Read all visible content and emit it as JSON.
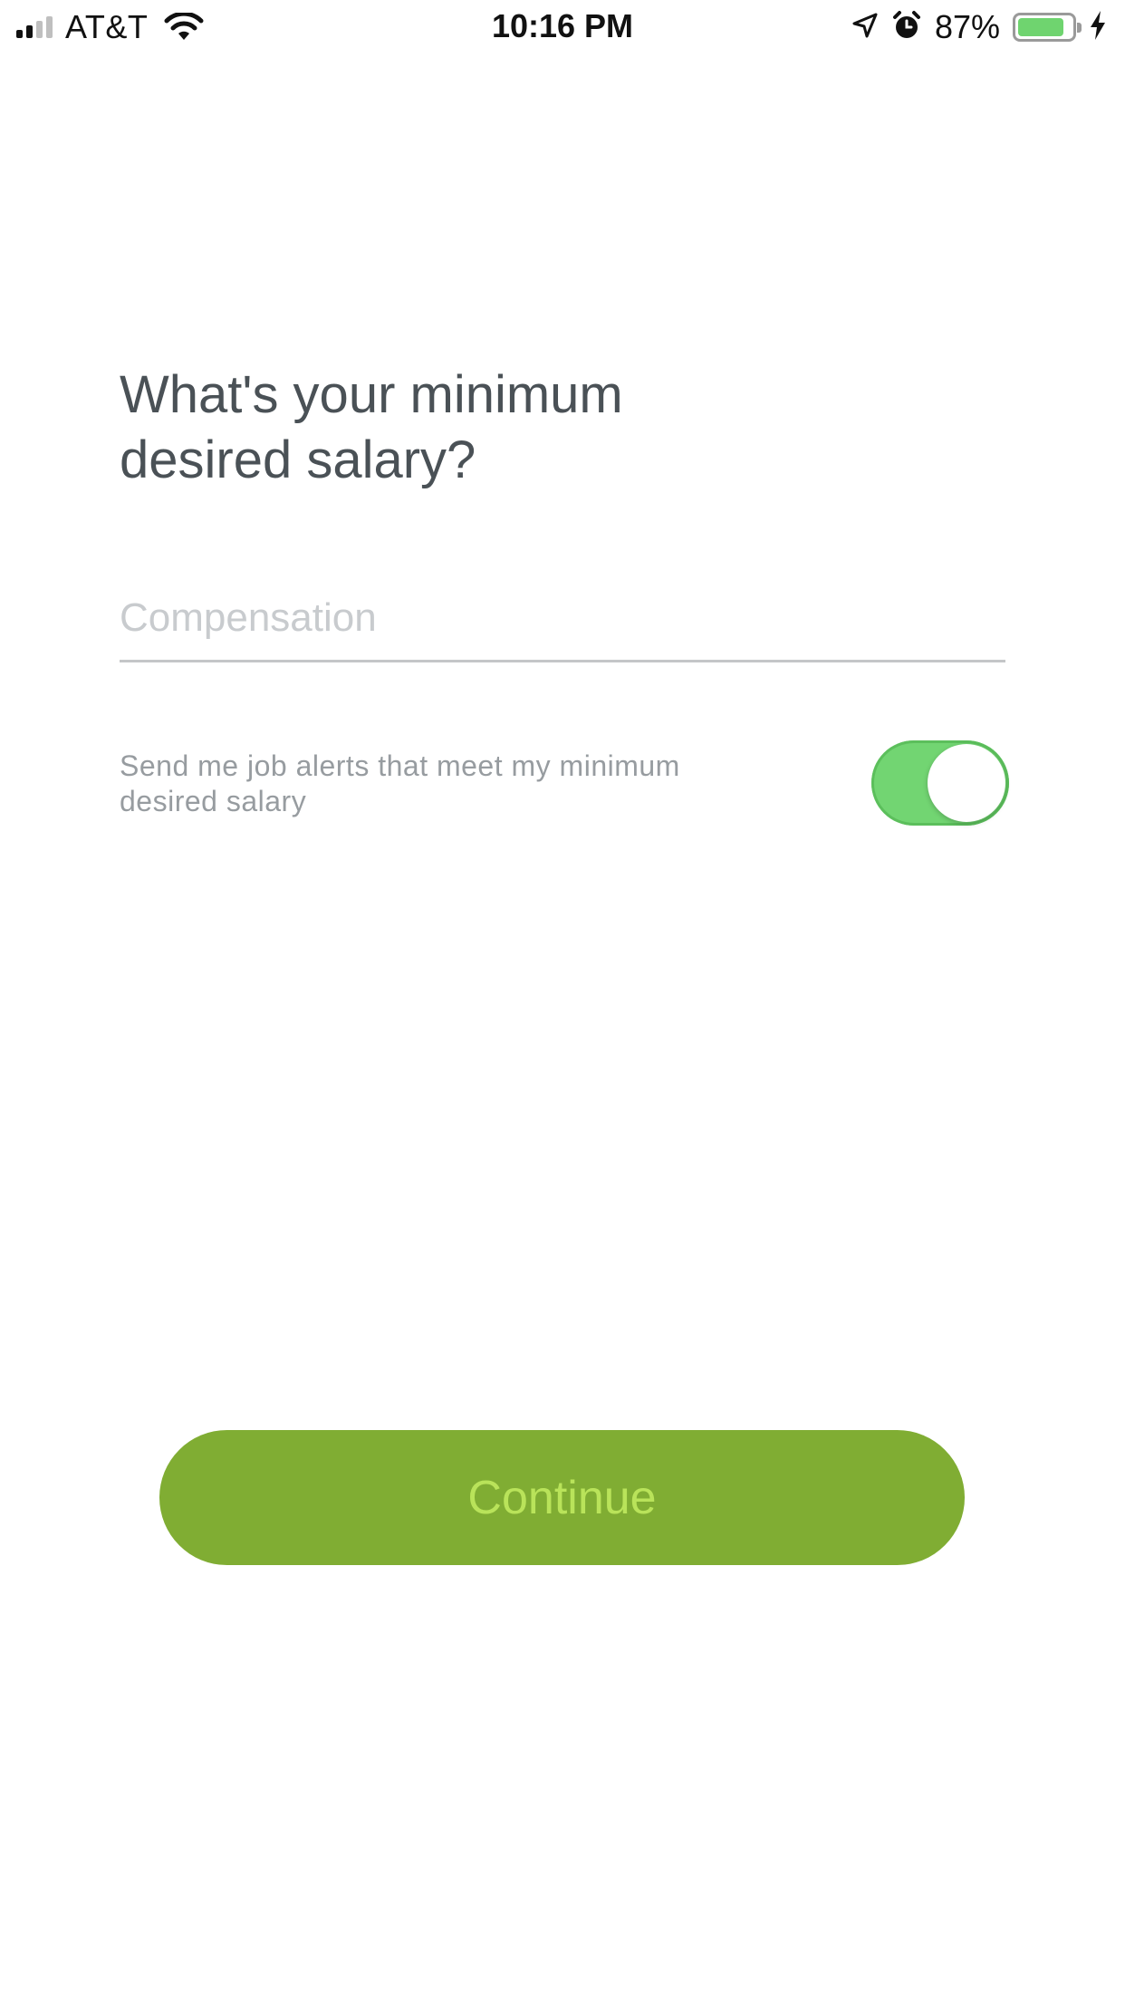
{
  "status_bar": {
    "carrier": "AT&T",
    "time": "10:16 PM",
    "battery_percent_label": "87%",
    "battery_level": 0.87,
    "signal_bars_filled": 2,
    "signal_bars_total": 4,
    "icons": [
      "signal-icon",
      "wifi-icon",
      "location-arrow-icon",
      "alarm-icon",
      "battery-icon",
      "charging-bolt-icon"
    ],
    "battery_color": "#6fd46f"
  },
  "page": {
    "title_line1": "What's your minimum",
    "title_line2": "desired salary?",
    "compensation": {
      "placeholder": "Compensation",
      "value": ""
    },
    "job_alerts": {
      "label": "Send me job alerts that meet my minimum desired salary",
      "enabled": true,
      "toggle_color": "#72d572"
    },
    "continue_label": "Continue",
    "continue_color": "#80ad33",
    "continue_text_color": "#b9e35a"
  }
}
